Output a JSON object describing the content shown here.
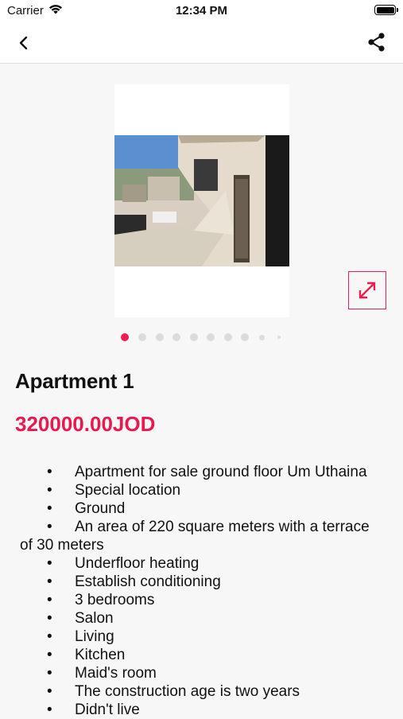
{
  "status_bar": {
    "carrier": "Carrier",
    "time": "12:34 PM"
  },
  "nav": {
    "back_icon": "chevron-left-icon",
    "share_icon": "share-icon"
  },
  "gallery": {
    "page_count": 10,
    "active_page": 1,
    "expand_icon": "expand-arrows-icon"
  },
  "property": {
    "title": "Apartment 1",
    "price": "320000.00JOD",
    "bullet": "•",
    "features": [
      "Apartment for sale ground floor Um Uthaina",
      "Special location",
      "Ground",
      "An area of 220 square meters with a terrace",
      "of 30 meters",
      "Underfloor heating",
      "Establish conditioning",
      "3 bedrooms",
      "Salon",
      "Living",
      "Kitchen",
      "Maid's room",
      "The construction age is two years",
      "Didn't live"
    ]
  },
  "colors": {
    "accent": "#ee1d4f",
    "price": "#e8194f",
    "dot_inactive": "#dcdcdc"
  }
}
